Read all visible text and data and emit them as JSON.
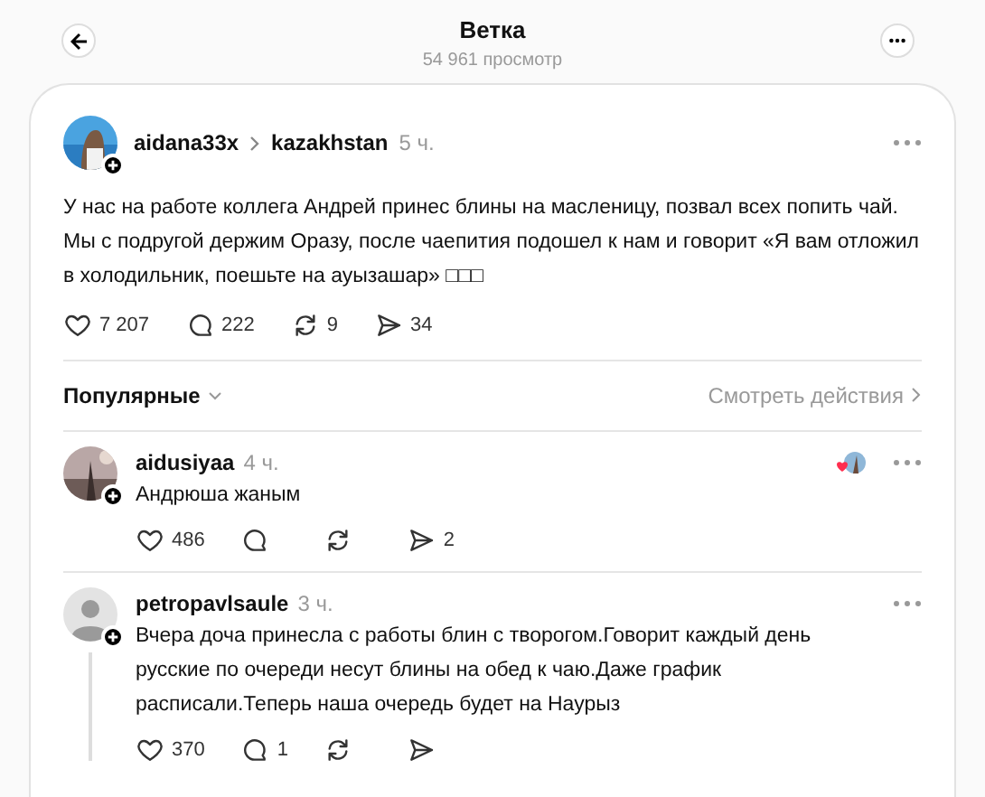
{
  "header": {
    "title": "Ветка",
    "subtitle": "54 961 просмотр"
  },
  "post": {
    "author": "aidana33x",
    "community": "kazakhstan",
    "time": "5 ч.",
    "text": "У нас на работе коллега Андрей принес блины на масленицу, позвал всех попить чай. Мы с подругой держим Оразу, после чаепития подошел к нам и говорит «Я вам отложил в холодильник, поешьте на ауызашар» □□□",
    "actions": [
      {
        "kind": "like",
        "count": "7 207"
      },
      {
        "kind": "comment",
        "count": "222"
      },
      {
        "kind": "repost",
        "count": "9"
      },
      {
        "kind": "share",
        "count": "34"
      }
    ]
  },
  "sort": {
    "label": "Популярные",
    "activity_link": "Смотреть действия"
  },
  "replies": [
    {
      "author": "aidusiyaa",
      "time": "4 ч.",
      "author_liked": true,
      "thread_line": false,
      "text": "Андрюша жаным",
      "actions": [
        {
          "kind": "like",
          "count": "486"
        },
        {
          "kind": "comment"
        },
        {
          "kind": "repost"
        },
        {
          "kind": "share",
          "count": "2"
        }
      ]
    },
    {
      "author": "petropavlsaule",
      "time": "3 ч.",
      "avatar": {
        "kind": "default"
      },
      "author_liked": false,
      "thread_line": true,
      "text": "Вчера доча принесла с работы блин с творогом.Говорит каждый день русские по очереди несут блины на обед к чаю.Даже график расписали.Теперь наша очередь будет на Наурыз",
      "actions": [
        {
          "kind": "like",
          "count": "370"
        },
        {
          "kind": "comment",
          "count": "1"
        },
        {
          "kind": "repost"
        },
        {
          "kind": "share"
        }
      ]
    }
  ]
}
